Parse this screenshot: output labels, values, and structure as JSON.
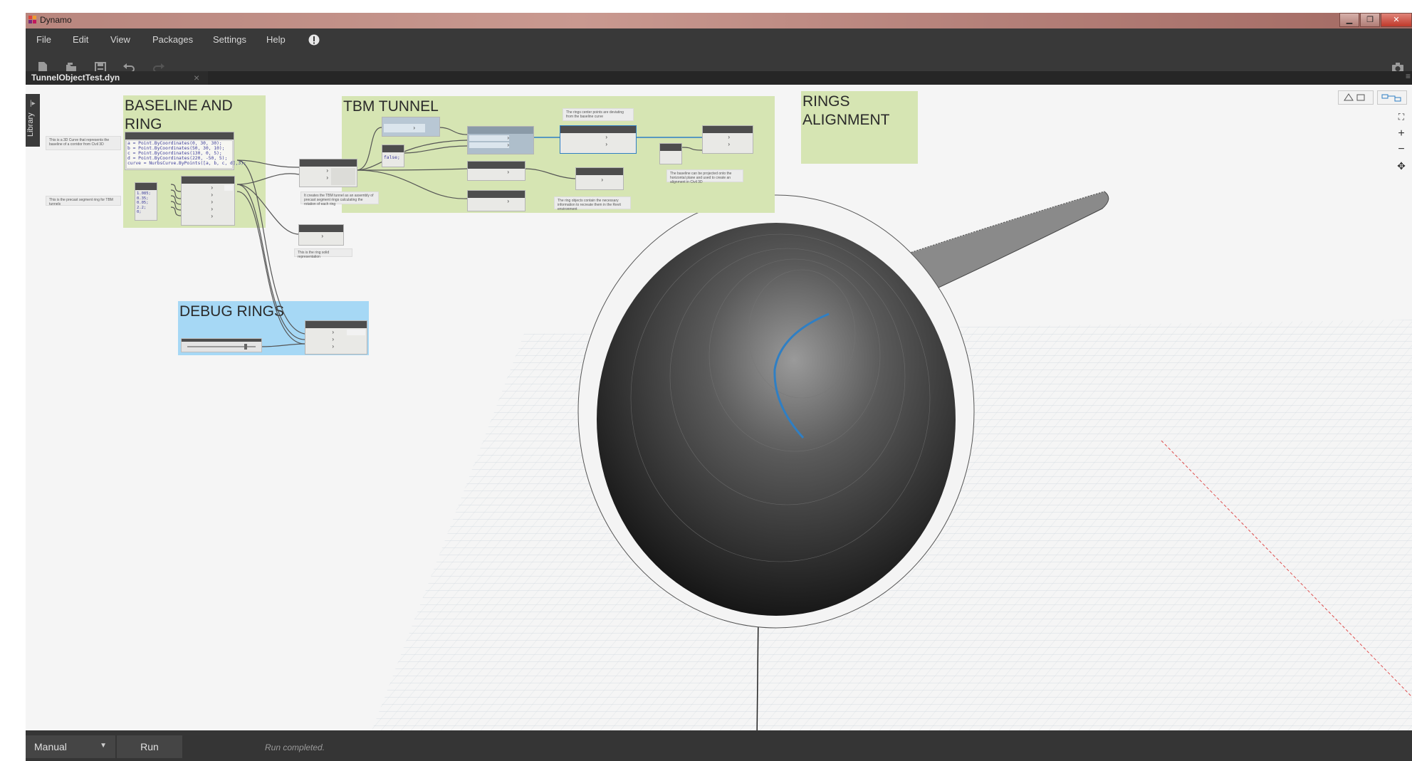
{
  "window": {
    "title": "Dynamo"
  },
  "menu": {
    "items": [
      "File",
      "Edit",
      "View",
      "Packages",
      "Settings",
      "Help"
    ]
  },
  "tab": {
    "filename": "TunnelObjectTest.dyn",
    "close": "×"
  },
  "library": {
    "label": "Library"
  },
  "groups": {
    "baseline": {
      "title": "BASELINE AND RING",
      "color": "#d6e5b3"
    },
    "tbm": {
      "title": "TBM TUNNEL",
      "color": "#d6e5b3"
    },
    "rings": {
      "title": "RINGS ALIGNMENT",
      "color": "#d6e5b3"
    },
    "debug": {
      "title": "DEBUG RINGS",
      "color": "#a6d8f5"
    }
  },
  "code_block": {
    "lines": [
      "a = Point.ByCoordinates(0, 30, 30);",
      "b = Point.ByCoordinates(50, 30, 10);",
      "c = Point.ByCoordinates(130, 0, 5);",
      "d = Point.ByCoordinates(220, -50, 5);",
      "curve = NurbsCurve.ByPoints([a, b, c, d],3);"
    ]
  },
  "values_block": {
    "lines": [
      "1.085;",
      "0.35;",
      "0.05;",
      "2.2;",
      "0;"
    ]
  },
  "bool_node": {
    "value": "false;"
  },
  "notes": {
    "baseline_curve": "This is a 3D Curve that represents the baseline of a corridor from Civil 3D",
    "precast_ring": "This is the precast segment ring for TBM tunnels",
    "tbm_creates": "It creates the TBM tunnel as an assembly of precast segment rings calculating the rotation of each ring",
    "ring_centers": "The rings center points are deviating from the baseline curve",
    "ring_objects": "The ring objects contain the necessary information to recreate them in the Revit environment",
    "ring_solid": "This is the ring solid representation",
    "baseline_projected": "The baseline can be projected onto the horizontal plane and used to create an alignment in Civil 3D"
  },
  "status": {
    "run_mode": "Manual",
    "run_button": "Run",
    "message": "Run completed."
  },
  "colors": {
    "dark_chrome": "#393939",
    "status_bar": "#353535",
    "selected_wire": "#2f7fc4",
    "debug_group": "#a6d8f5",
    "group_green": "#d6e5b3"
  }
}
